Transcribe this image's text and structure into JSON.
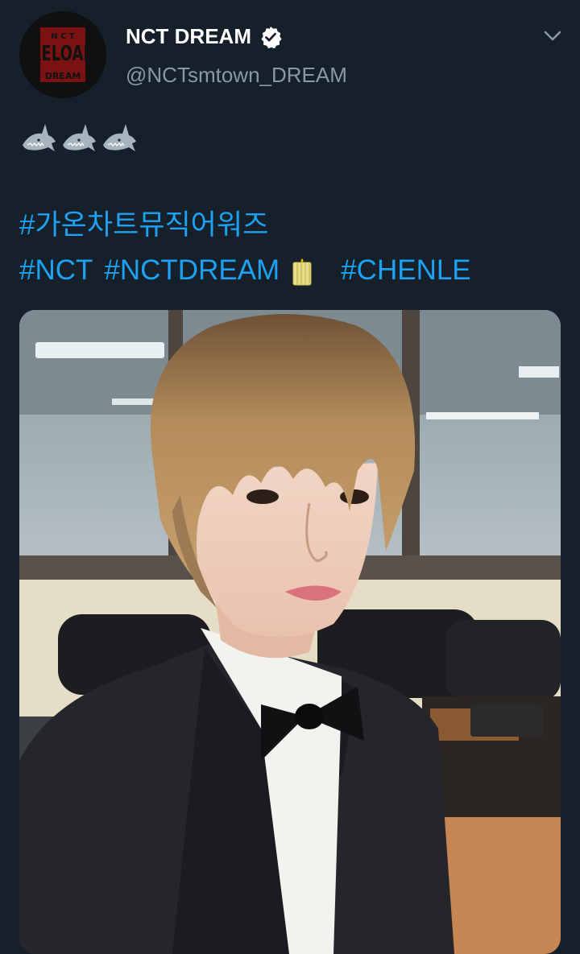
{
  "account": {
    "display_name": "NCT DREAM",
    "handle": "@NCTsmtown_DREAM",
    "avatar_text": [
      "N C T",
      "RELOAD",
      "DREAM"
    ]
  },
  "tweet": {
    "emoji": [
      "shark",
      "shark",
      "shark"
    ],
    "hashtag_line_1": [
      "#가온차트뮤직어워즈"
    ],
    "hashtag_line_2": [
      "#NCT",
      "#NCTDREAM",
      "#CHENLE"
    ],
    "hashtag_line_2_emoji": "candle"
  },
  "colors": {
    "background": "#15202b",
    "hashtag": "#1da1f2",
    "secondary_text": "#8899a6"
  },
  "icons": {
    "verified": "verified-badge-icon",
    "more": "chevron-down-icon"
  }
}
